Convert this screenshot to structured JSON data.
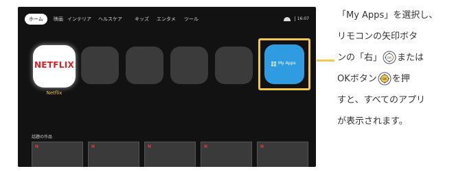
{
  "tv": {
    "tabs": [
      "ホーム",
      "映画",
      "インテリア",
      "ヘルスケア",
      "キッズ",
      "エンタメ",
      "ツール"
    ],
    "time": "16:07",
    "apps": [
      {
        "name": "Netflix",
        "logo": "NETFLIX",
        "focused": true
      },
      {
        "name": ""
      },
      {
        "name": ""
      },
      {
        "name": ""
      },
      {
        "name": ""
      },
      {
        "name": "My Apps",
        "highlighted": true
      }
    ],
    "section_title": "話題の作品",
    "cards": [
      "N",
      "N",
      "N",
      "N",
      "N"
    ]
  },
  "instructions": {
    "line1": "「My Apps」を選択し、",
    "line2": "リモコンの矢印ボタ",
    "line3_a": "ンの「右」",
    "line3_b": "または",
    "line4_a": "OKボタン",
    "line4_b": "を押",
    "line5": "すと、すべてのアプリ",
    "line6": "が表示されます。",
    "ok_label": "OK"
  },
  "colors": {
    "highlight": "#f2c94c",
    "netflix_red": "#d81f26",
    "myapps_blue": "#2f9be0"
  }
}
